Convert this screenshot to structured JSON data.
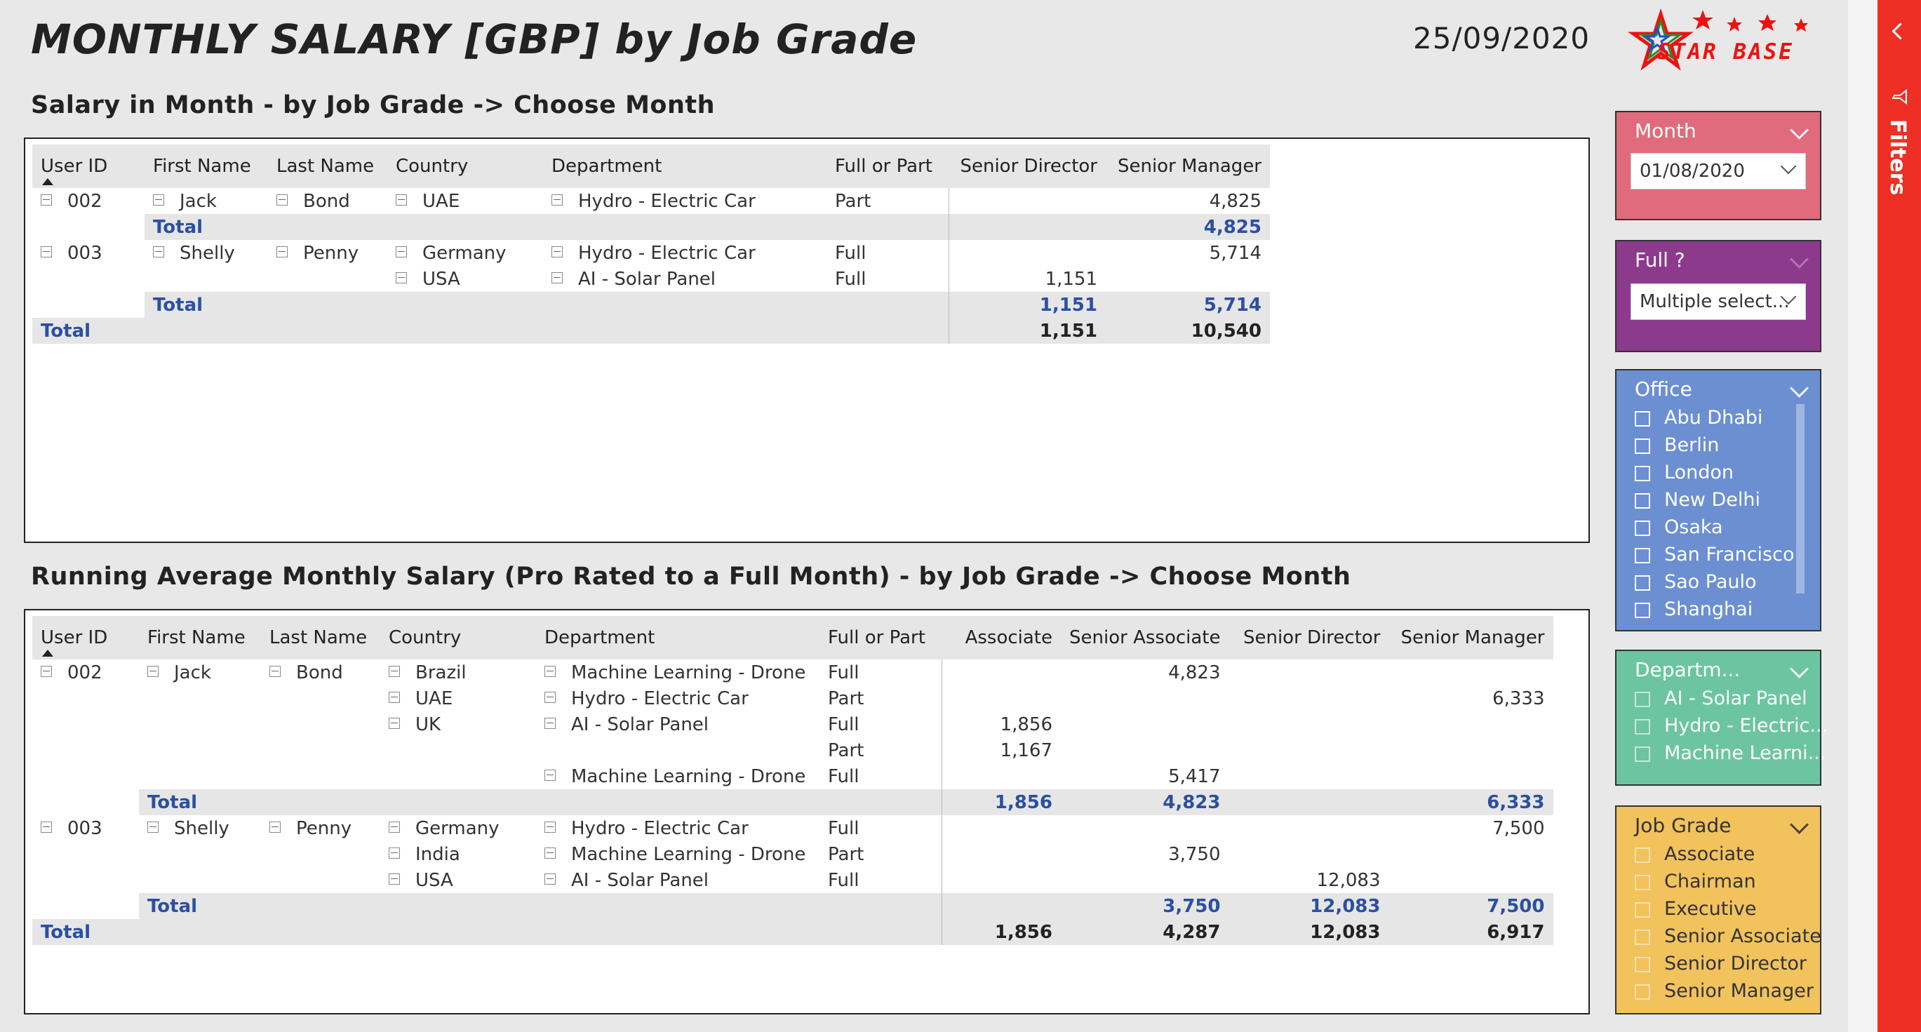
{
  "header": {
    "title": "MONTHLY SALARY [GBP] by Job Grade",
    "date": "25/09/2020",
    "logo_text": "STAR BASE"
  },
  "table1": {
    "title": "Salary in Month - by Job Grade -> Choose Month",
    "columns": [
      "User ID",
      "First Name",
      "Last Name",
      "Country",
      "Department",
      "Full or Part",
      "Senior Director",
      "Senior Manager"
    ],
    "rows": [
      {
        "type": "row",
        "user_id": "002",
        "first": "Jack",
        "last": "Bond",
        "country": "UAE",
        "dept": "Hydro - Electric Car",
        "fp": "Part",
        "sd": "",
        "sm": "4,825"
      },
      {
        "type": "sub",
        "label": "Total",
        "sd": "",
        "sm": "4,825"
      },
      {
        "type": "row",
        "user_id": "003",
        "first": "Shelly",
        "last": "Penny",
        "country": "Germany",
        "dept": "Hydro - Electric Car",
        "fp": "Full",
        "sd": "",
        "sm": "5,714"
      },
      {
        "type": "row",
        "user_id": "",
        "first": "",
        "last": "",
        "country": "USA",
        "dept": "AI - Solar Panel",
        "fp": "Full",
        "sd": "1,151",
        "sm": ""
      },
      {
        "type": "sub",
        "label": "Total",
        "sd": "1,151",
        "sm": "5,714"
      },
      {
        "type": "grand",
        "label": "Total",
        "sd": "1,151",
        "sm": "10,540"
      }
    ]
  },
  "table2": {
    "title": "Running Average Monthly Salary (Pro Rated to a Full Month) - by Job Grade -> Choose Month",
    "columns": [
      "User ID",
      "First Name",
      "Last Name",
      "Country",
      "Department",
      "Full or Part",
      "Associate",
      "Senior Associate",
      "Senior Director",
      "Senior Manager"
    ],
    "rows": [
      {
        "type": "row",
        "user_id": "002",
        "first": "Jack",
        "last": "Bond",
        "country": "Brazil",
        "dept": "Machine Learning - Drone",
        "fp": "Full",
        "a": "",
        "sa": "4,823",
        "sd": "",
        "sm": ""
      },
      {
        "type": "row",
        "user_id": "",
        "first": "",
        "last": "",
        "country": "UAE",
        "dept": "Hydro - Electric Car",
        "fp": "Part",
        "a": "",
        "sa": "",
        "sd": "",
        "sm": "6,333"
      },
      {
        "type": "row",
        "user_id": "",
        "first": "",
        "last": "",
        "country": "UK",
        "dept": "AI - Solar Panel",
        "fp": "Full",
        "a": "1,856",
        "sa": "",
        "sd": "",
        "sm": ""
      },
      {
        "type": "row",
        "user_id": "",
        "first": "",
        "last": "",
        "country": "",
        "dept": "",
        "fp": "Part",
        "a": "1,167",
        "sa": "",
        "sd": "",
        "sm": ""
      },
      {
        "type": "row",
        "user_id": "",
        "first": "",
        "last": "",
        "country": "",
        "dept": "Machine Learning - Drone",
        "fp": "Full",
        "a": "",
        "sa": "5,417",
        "sd": "",
        "sm": ""
      },
      {
        "type": "sub",
        "label": "Total",
        "a": "1,856",
        "sa": "4,823",
        "sd": "",
        "sm": "6,333"
      },
      {
        "type": "row",
        "user_id": "003",
        "first": "Shelly",
        "last": "Penny",
        "country": "Germany",
        "dept": "Hydro - Electric Car",
        "fp": "Full",
        "a": "",
        "sa": "",
        "sd": "",
        "sm": "7,500"
      },
      {
        "type": "row",
        "user_id": "",
        "first": "",
        "last": "",
        "country": "India",
        "dept": "Machine Learning - Drone",
        "fp": "Part",
        "a": "",
        "sa": "3,750",
        "sd": "",
        "sm": ""
      },
      {
        "type": "row",
        "user_id": "",
        "first": "",
        "last": "",
        "country": "USA",
        "dept": "AI - Solar Panel",
        "fp": "Full",
        "a": "",
        "sa": "",
        "sd": "12,083",
        "sm": ""
      },
      {
        "type": "sub",
        "label": "Total",
        "a": "",
        "sa": "3,750",
        "sd": "12,083",
        "sm": "7,500"
      },
      {
        "type": "grand",
        "label": "Total",
        "a": "1,856",
        "sa": "4,287",
        "sd": "12,083",
        "sm": "6,917"
      }
    ]
  },
  "slicers": {
    "month": {
      "label": "Month",
      "value": "01/08/2020",
      "color": "#e06b7d"
    },
    "full": {
      "label": "Full ?",
      "value": "Multiple select...",
      "color": "#8c3a8c"
    },
    "office": {
      "label": "Office",
      "color": "#6b8fd1",
      "items": [
        "Abu Dhabi",
        "Berlin",
        "London",
        "New Delhi",
        "Osaka",
        "San Francisco",
        "Sao Paulo",
        "Shanghai"
      ]
    },
    "department": {
      "label": "Departm...",
      "color": "#6cc5a0",
      "items": [
        "AI - Solar Panel",
        "Hydro - Electric...",
        "Machine Learni..."
      ]
    },
    "job_grade": {
      "label": "Job Grade",
      "color": "#f2c25c",
      "items": [
        "Associate",
        "Chairman",
        "Executive",
        "Senior Associate",
        "Senior Director",
        "Senior Manager"
      ]
    }
  },
  "filters_pane": {
    "label": "Filters",
    "color": "#ee2f25"
  }
}
